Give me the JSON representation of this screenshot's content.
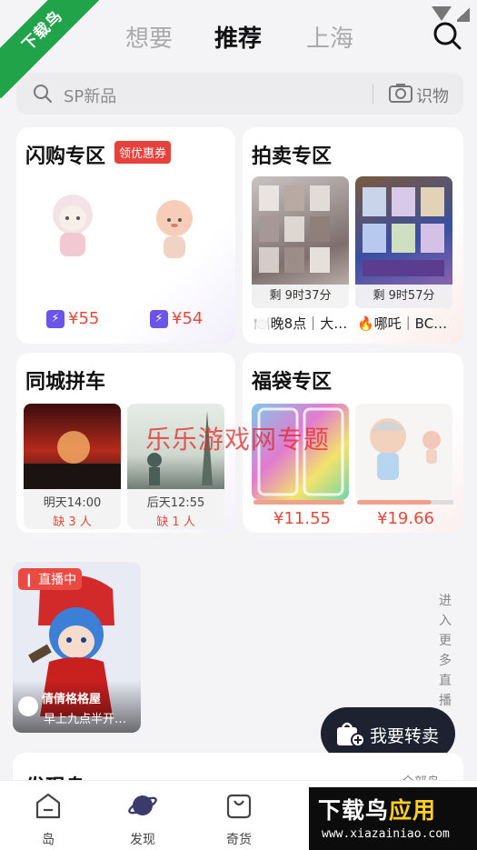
{
  "corner_badge": "下载鸟",
  "header": {
    "tabs": [
      {
        "label": "想要"
      },
      {
        "label": "推荐",
        "active": true
      },
      {
        "label": "上海"
      }
    ]
  },
  "search": {
    "placeholder": "SP新品",
    "camera_label": "识物"
  },
  "flash_sale": {
    "title": "闪购专区",
    "coupon": "领优惠券",
    "items": [
      {
        "price": "¥55"
      },
      {
        "price": "¥54"
      }
    ]
  },
  "auction": {
    "title": "拍卖专区",
    "items": [
      {
        "timer": "剩 9时37分",
        "text": "🍽️晚8点｜大…"
      },
      {
        "timer": "剩 9时57分",
        "text": "🔥哪吒｜BC…"
      }
    ]
  },
  "carpool": {
    "title": "同城拼车",
    "items": [
      {
        "time": "明天14:00",
        "lack": "缺 3 人"
      },
      {
        "time": "后天12:55",
        "lack": "缺 1 人"
      }
    ]
  },
  "lucky_bag": {
    "title": "福袋专区",
    "items": [
      {
        "price": "¥11.55"
      },
      {
        "price": "¥19.66"
      }
    ]
  },
  "watermark": "乐乐游戏网专题",
  "live": {
    "badge": "直播中",
    "host": "倩倩格格屋",
    "desc": "早上九点半开…"
  },
  "more_live": [
    "进",
    "入",
    "更",
    "多",
    "直",
    "播"
  ],
  "resell_button": "我要转卖",
  "discover": {
    "title": "发现岛",
    "all": "全部岛 ›"
  },
  "bottom_nav": [
    {
      "label": "岛"
    },
    {
      "label": "发现"
    },
    {
      "label": "奇货"
    }
  ],
  "brand": {
    "title_part1": "下载鸟",
    "title_part2": "应用",
    "url": "www.xiazainiao.com"
  },
  "colors": {
    "accent_red": "#e24a3b",
    "flash_purple": "#6a55e8",
    "corner_green": "#21a34a"
  }
}
